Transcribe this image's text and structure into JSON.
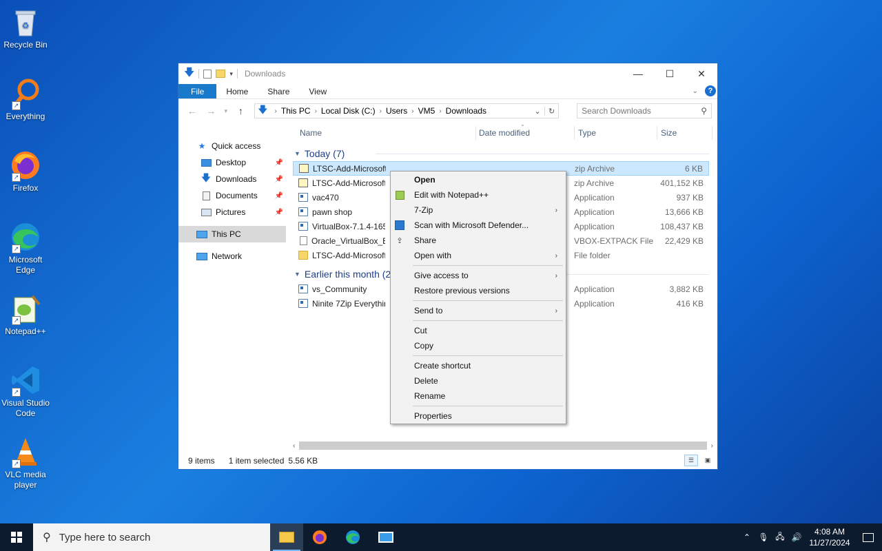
{
  "desktop": {
    "icons": [
      {
        "label": "Recycle Bin"
      },
      {
        "label": "Everything"
      },
      {
        "label": "Firefox"
      },
      {
        "label": "Microsoft Edge"
      },
      {
        "label": "Notepad++"
      },
      {
        "label": "Visual Studio Code"
      },
      {
        "label": "VLC media player"
      }
    ]
  },
  "window": {
    "title": "Downloads",
    "ribbon_tabs": [
      "File",
      "Home",
      "Share",
      "View"
    ],
    "breadcrumb": [
      "This PC",
      "Local Disk (C:)",
      "Users",
      "VM5",
      "Downloads"
    ],
    "search_placeholder": "Search Downloads",
    "columns": {
      "name": "Name",
      "date": "Date modified",
      "type": "Type",
      "size": "Size"
    },
    "nav": [
      {
        "label": "Quick access"
      },
      {
        "label": "Desktop"
      },
      {
        "label": "Downloads"
      },
      {
        "label": "Documents"
      },
      {
        "label": "Pictures"
      },
      {
        "label": "This PC"
      },
      {
        "label": "Network"
      }
    ],
    "groups": [
      {
        "label": "Today (7)",
        "rows": [
          {
            "name": "LTSC-Add-MicrosoftStore",
            "type": "zip Archive",
            "size": "6 KB",
            "icon": "zip"
          },
          {
            "name": "LTSC-Add-MicrosoftStore",
            "type": "zip Archive",
            "size": "401,152 KB",
            "icon": "zip"
          },
          {
            "name": "vac470",
            "type": "Application",
            "size": "937 KB",
            "icon": "app"
          },
          {
            "name": "pawn shop",
            "type": "Application",
            "size": "13,666 KB",
            "icon": "app"
          },
          {
            "name": "VirtualBox-7.1.4-165100-Win",
            "type": "Application",
            "size": "108,437 KB",
            "icon": "app"
          },
          {
            "name": "Oracle_VirtualBox_Extension_Pack",
            "type": "VBOX-EXTPACK File",
            "size": "22,429 KB",
            "icon": "doc"
          },
          {
            "name": "LTSC-Add-MicrosoftStore",
            "type": "File folder",
            "size": "",
            "icon": "folder"
          }
        ]
      },
      {
        "label": "Earlier this month (2)",
        "rows": [
          {
            "name": "vs_Community",
            "type": "Application",
            "size": "3,882 KB",
            "icon": "app"
          },
          {
            "name": "Ninite 7Zip Everything Installer",
            "type": "Application",
            "size": "416 KB",
            "icon": "app"
          }
        ]
      }
    ],
    "status": {
      "items": "9 items",
      "selected": "1 item selected",
      "size": "5.56 KB"
    }
  },
  "context_menu": {
    "items": [
      {
        "label": "Open",
        "bold": true
      },
      {
        "label": "Edit with Notepad++"
      },
      {
        "label": "7-Zip",
        "submenu": true
      },
      {
        "label": "Scan with Microsoft Defender..."
      },
      {
        "label": "Share"
      },
      {
        "label": "Open with",
        "submenu": true
      },
      {
        "label": "Give access to",
        "submenu": true
      },
      {
        "label": "Restore previous versions"
      },
      {
        "label": "Send to",
        "submenu": true
      },
      {
        "label": "Cut"
      },
      {
        "label": "Copy"
      },
      {
        "label": "Create shortcut"
      },
      {
        "label": "Delete"
      },
      {
        "label": "Rename"
      },
      {
        "label": "Properties"
      }
    ]
  },
  "taskbar": {
    "search_placeholder": "Type here to search",
    "time": "4:08 AM",
    "date": "11/27/2024"
  },
  "colors": {
    "accent": "#1979ca",
    "selection": "#cce8ff",
    "taskbar": "#0d1b2e"
  }
}
